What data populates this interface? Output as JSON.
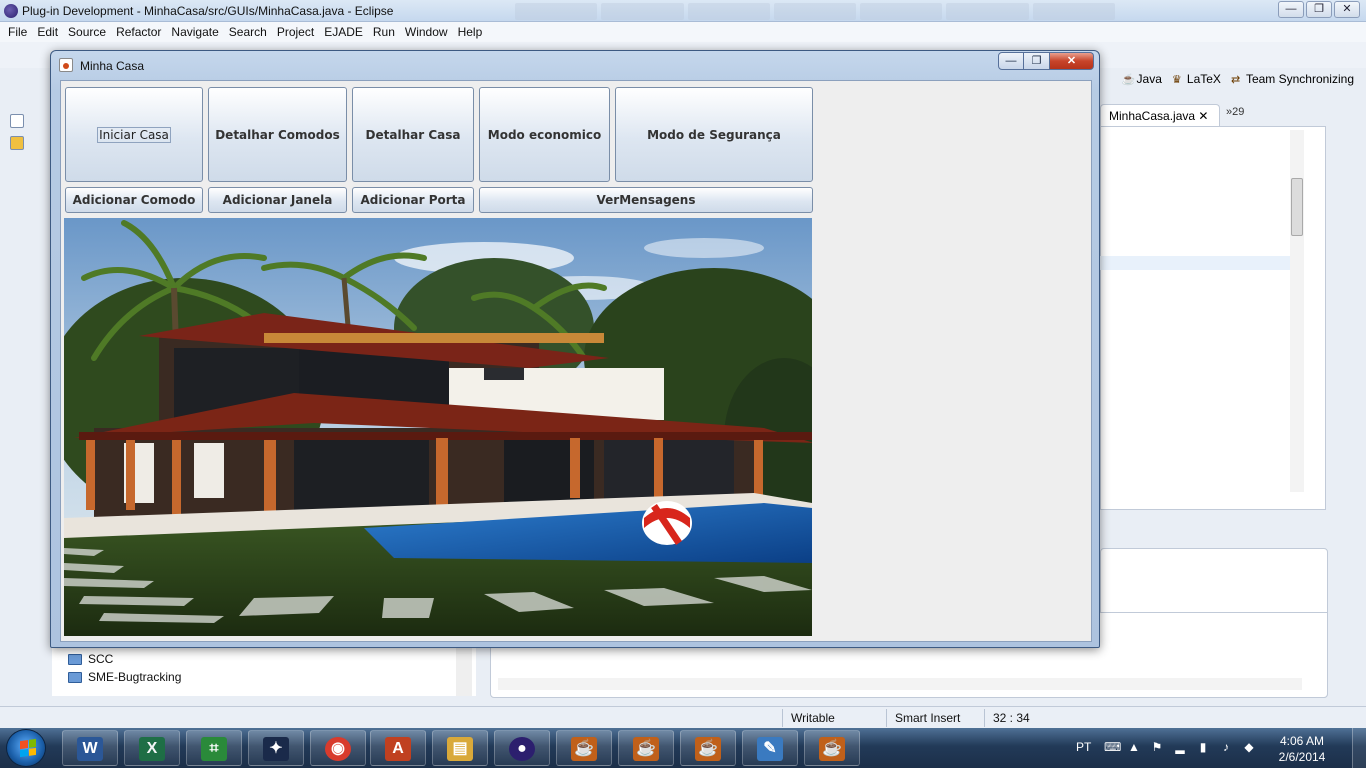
{
  "eclipse": {
    "title": "Plug-in Development - MinhaCasa/src/GUIs/MinhaCasa.java - Eclipse",
    "window_controls": [
      "—",
      "❐",
      "✕"
    ],
    "menu": [
      "File",
      "Edit",
      "Source",
      "Refactor",
      "Navigate",
      "Search",
      "Project",
      "EJADE",
      "Run",
      "Window",
      "Help"
    ],
    "perspectives": [
      "Java",
      "LaTeX",
      "Team Synchronizing"
    ],
    "editor_tab": "MinhaCasa.java",
    "editor_more": "»29",
    "explorer_items": [
      "SCC",
      "SME-Bugtracking"
    ],
    "status": {
      "writable": "Writable",
      "insert_mode": "Smart Insert",
      "position": "32 : 34"
    }
  },
  "window": {
    "title": "Minha Casa",
    "buttons_top": [
      "Iniciar Casa",
      "Detalhar Comodos",
      "Detalhar Casa",
      "Modo economico",
      "Modo de Segurança"
    ],
    "buttons_bottom": [
      "Adicionar Comodo",
      "Adicionar Janela",
      "Adicionar Porta",
      "VerMensagens"
    ],
    "controls": [
      "—",
      "❐",
      "✕"
    ]
  },
  "taskbar": {
    "apps": [
      {
        "icon": "word-icon",
        "glyph": "W",
        "color": "#2b5797"
      },
      {
        "icon": "excel-icon",
        "glyph": "X",
        "color": "#1e7145"
      },
      {
        "icon": "diagram-icon",
        "glyph": "⌗",
        "color": "#2a8a3a"
      },
      {
        "icon": "bird-icon",
        "glyph": "✦",
        "color": "#1a2a4a"
      },
      {
        "icon": "chrome-icon",
        "glyph": "◉",
        "color": "#d83b2d"
      },
      {
        "icon": "document-icon",
        "glyph": "A",
        "color": "#c04020"
      },
      {
        "icon": "folder-icon",
        "glyph": "▤",
        "color": "#d9a93a"
      },
      {
        "icon": "eclipse-icon",
        "glyph": "●",
        "color": "#2c1f6e"
      },
      {
        "icon": "java-icon",
        "glyph": "☕",
        "color": "#c0601a"
      },
      {
        "icon": "java-icon",
        "glyph": "☕",
        "color": "#c0601a"
      },
      {
        "icon": "java-icon",
        "glyph": "☕",
        "color": "#c0601a"
      },
      {
        "icon": "paint-icon",
        "glyph": "✎",
        "color": "#3a7ac0"
      },
      {
        "icon": "java-icon",
        "glyph": "☕",
        "color": "#c0601a"
      }
    ],
    "language": "PT",
    "time": "4:06 AM",
    "date": "2/6/2014"
  }
}
